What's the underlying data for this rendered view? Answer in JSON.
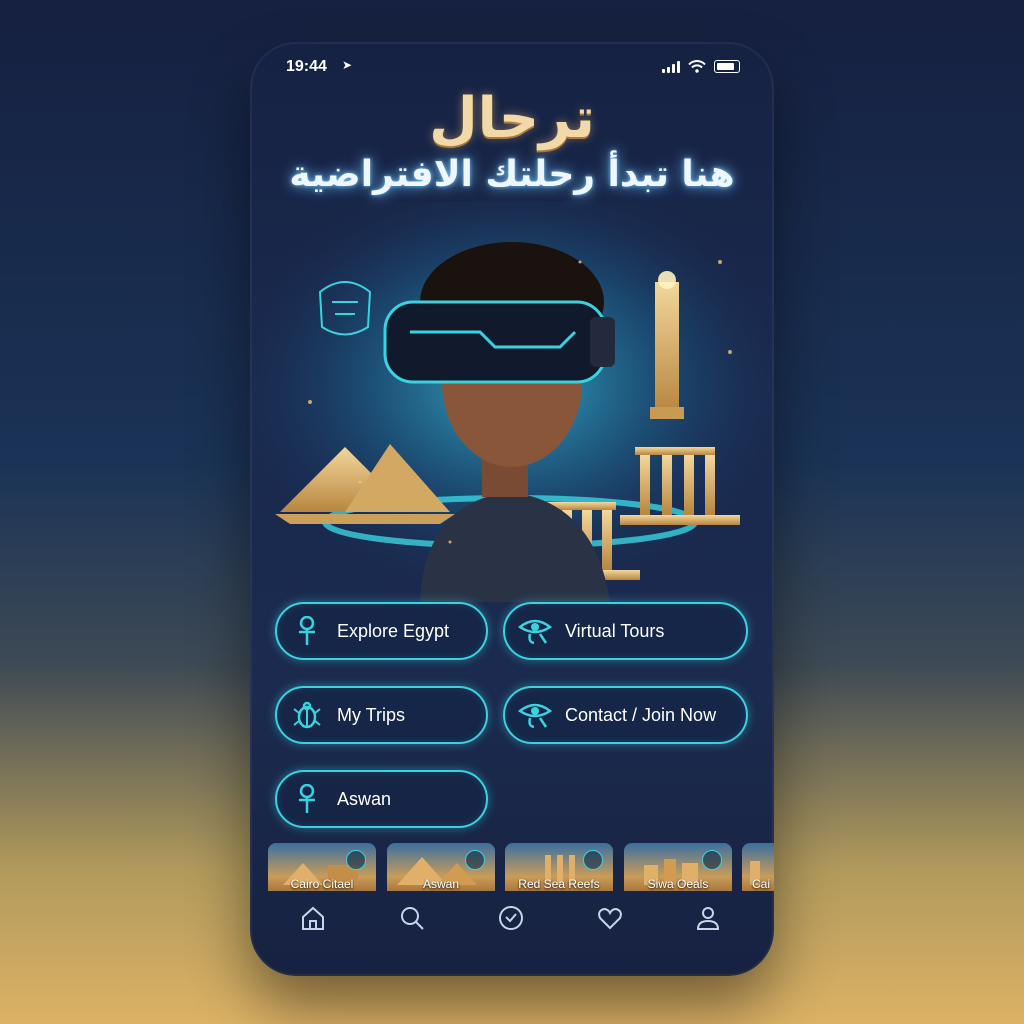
{
  "status": {
    "time": "19:44"
  },
  "header": {
    "title": "ترحال",
    "subtitle": "هنا تبدأ رحلتك الافتراضية"
  },
  "colors": {
    "accent": "#39d3e0",
    "title_gold": "#f1d9a8",
    "background": "#1a2a4f"
  },
  "menu": [
    {
      "label": "Explore Egypt",
      "icon": "ankh-icon"
    },
    {
      "label": "Virtual Tours",
      "icon": "eye-of-horus-icon"
    },
    {
      "label": "My Trips",
      "icon": "scarab-icon"
    },
    {
      "label": "Contact / Join Now",
      "icon": "eye-of-horus-icon"
    },
    {
      "label": "Aswan",
      "icon": "ankh-icon"
    }
  ],
  "destinations": [
    {
      "label": "Cairo Citael"
    },
    {
      "label": "Aswan"
    },
    {
      "label": "Red Sea Reefs"
    },
    {
      "label": "Siwa Oeals"
    },
    {
      "label": "Cai"
    }
  ],
  "tabbar": [
    "home-icon",
    "search-icon",
    "check-circle-icon",
    "heart-icon",
    "profile-icon"
  ]
}
